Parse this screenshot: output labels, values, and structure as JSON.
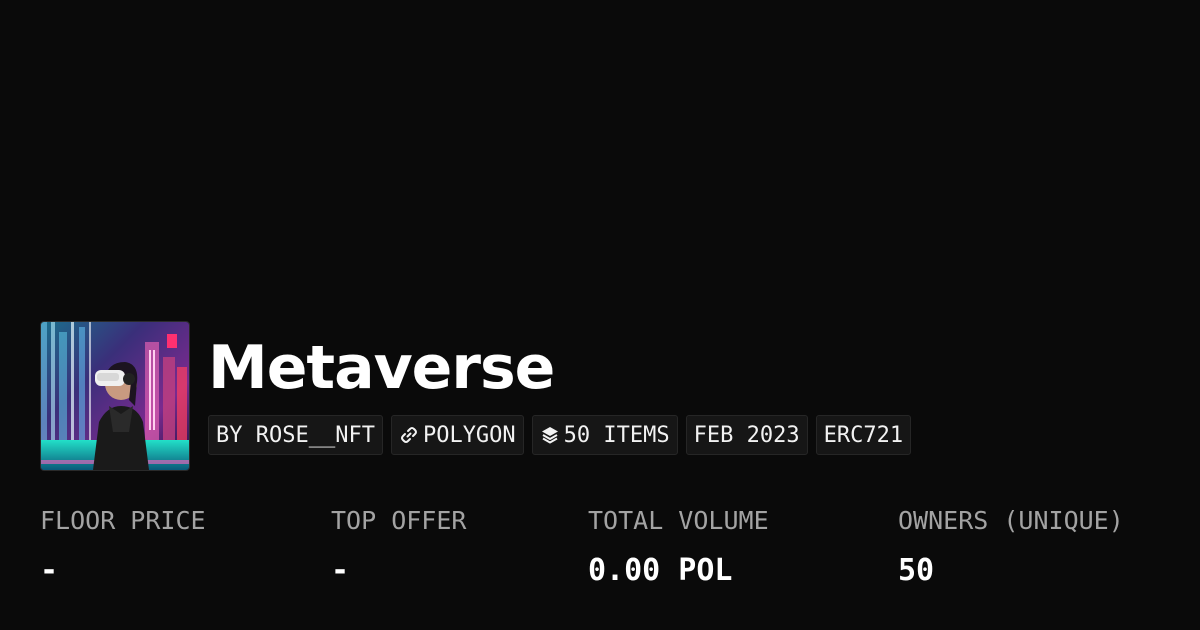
{
  "collection": {
    "title": "Metaverse",
    "avatar_alt": "collection-avatar"
  },
  "badges": {
    "creator": "BY ROSE__NFT",
    "chain": "POLYGON",
    "items": "50 ITEMS",
    "date": "FEB 2023",
    "standard": "ERC721"
  },
  "icons": {
    "chain": "chain-link-icon",
    "items": "layers-icon"
  },
  "stats": {
    "floor_price": {
      "label": "FLOOR PRICE",
      "value": "-"
    },
    "top_offer": {
      "label": "TOP OFFER",
      "value": "-"
    },
    "total_volume": {
      "label": "TOTAL VOLUME",
      "value": "0.00 POL"
    },
    "owners": {
      "label": "OWNERS (UNIQUE)",
      "value": "50"
    }
  },
  "colors": {
    "background": "#0a0a0a",
    "badge_bg": "#161616",
    "label": "#a3a3a3",
    "text": "#ffffff"
  }
}
